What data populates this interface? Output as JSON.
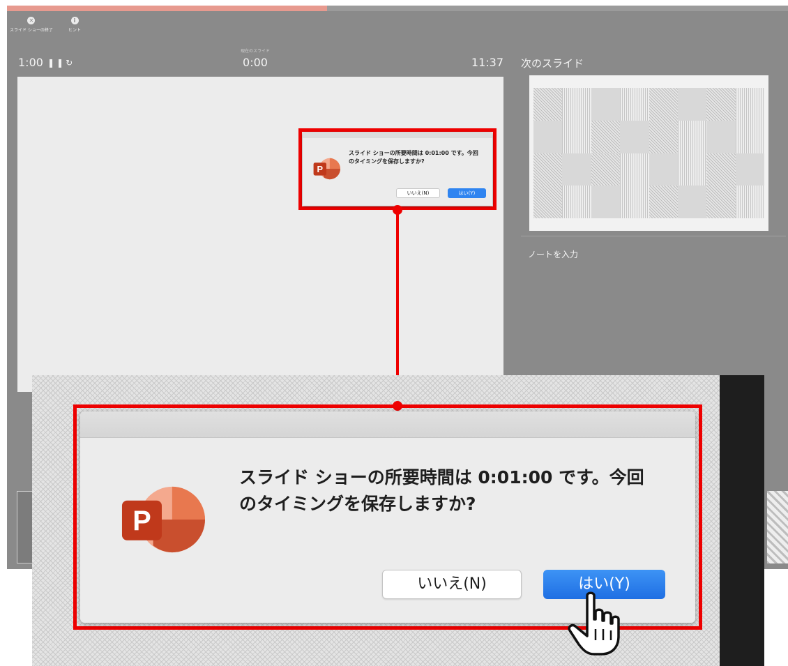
{
  "presenter": {
    "progress_fraction": 0.41,
    "toolbar": {
      "end_show_label": "スライド ショーの終了",
      "hint_label": "ヒント"
    },
    "timer": {
      "elapsed": "1:00",
      "slide_time_label": "現在のスライド",
      "slide_time": "0:00",
      "clock": "11:37"
    },
    "next_slide_label": "次のスライド",
    "notes_placeholder": "ノートを入力"
  },
  "dialog": {
    "message_line1": "スライド ショーの所要時間は 0:01:00 です。今回",
    "message_line2": "のタイミングを保存しますか?",
    "no_button": "いいえ(N)",
    "yes_button": "はい(Y)",
    "app_icon": "powerpoint-icon",
    "app_icon_letter": "P"
  },
  "colors": {
    "highlight": "#ee0000",
    "primary_button": "#2f84f0",
    "progress": "#e79a8f",
    "presenter_bg": "#8a8a8a"
  }
}
